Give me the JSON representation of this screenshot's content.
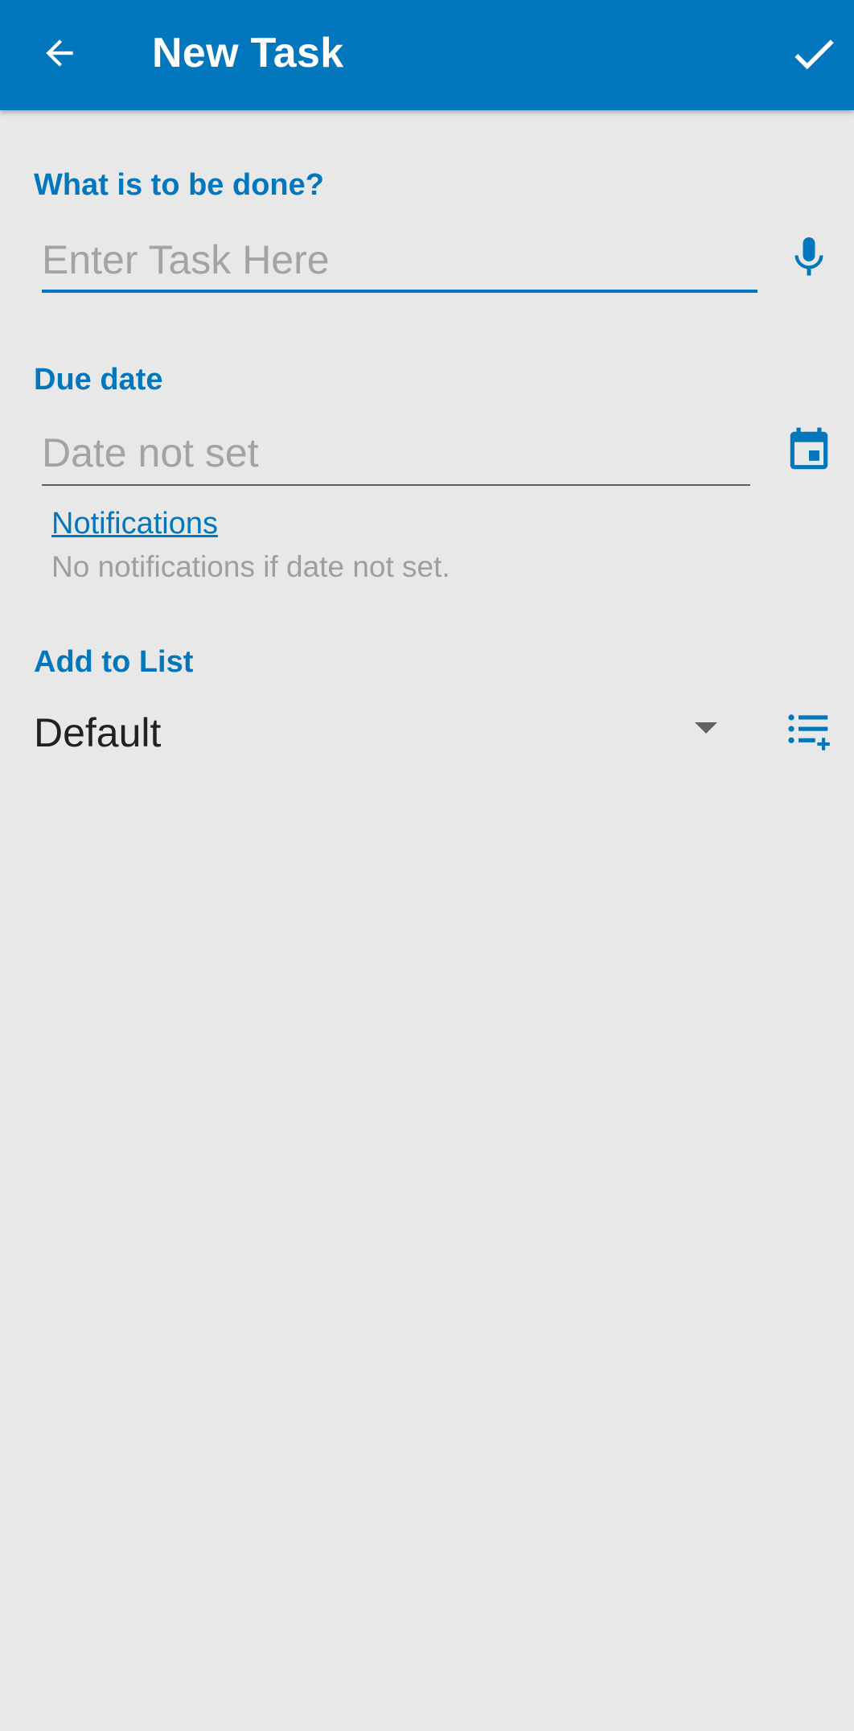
{
  "app_bar": {
    "title": "New Task",
    "back_icon": "arrow-back-icon",
    "confirm_icon": "check-icon",
    "background_color": "#0277bd"
  },
  "task_section": {
    "label": "What is to be done?",
    "input_value": "",
    "input_placeholder": "Enter Task Here",
    "voice_icon": "microphone-icon"
  },
  "due_date_section": {
    "label": "Due date",
    "input_value": "",
    "input_placeholder": "Date not set",
    "calendar_icon": "calendar-icon"
  },
  "notifications": {
    "link_label": "Notifications",
    "helper_text": "No notifications if date not set."
  },
  "list_section": {
    "label": "Add to List",
    "selected_value": "Default",
    "add_list_icon": "playlist-add-icon"
  },
  "colors": {
    "accent": "#0277bd",
    "background": "#e8e8e9",
    "hint_text": "#a3a3a3"
  }
}
